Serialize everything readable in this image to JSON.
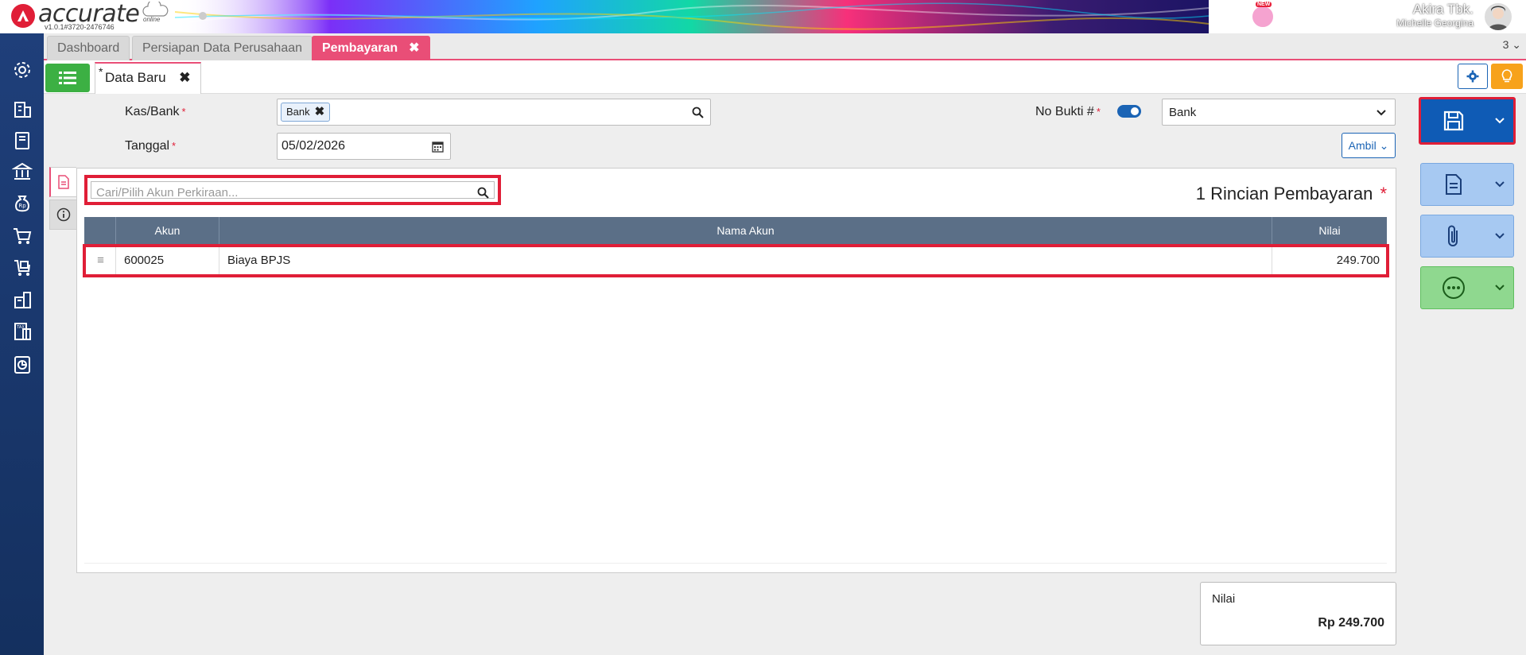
{
  "app": {
    "name": "accurate",
    "subtitle": "online",
    "version": "v1.0.1#3720-2476746"
  },
  "user": {
    "company": "Akira Tbk.",
    "name": "Michelle Georgina",
    "new_badge": "NEW"
  },
  "tabs": [
    {
      "label": "Dashboard"
    },
    {
      "label": "Persiapan Data Perusahaan"
    },
    {
      "label": "Pembayaran",
      "close": "✖"
    }
  ],
  "tab_count": "3",
  "doc_tab": {
    "label": "Data Baru",
    "modified_mark": "*",
    "close": "✖"
  },
  "form": {
    "kas_bank_label": "Kas/Bank",
    "kas_bank_value": "Bank",
    "tanggal_label": "Tanggal",
    "tanggal_value": "05/02/2026",
    "no_bukti_label": "No Bukti #",
    "no_bukti_type": "Bank",
    "required_mark": "*",
    "ambil_label": "Ambil"
  },
  "detail": {
    "search_placeholder": "Cari/Pilih Akun Perkiraan...",
    "title": "1 Rincian Pembayaran",
    "columns": [
      "Akun",
      "Nama Akun",
      "Nilai"
    ],
    "rows": [
      {
        "akun": "600025",
        "nama_akun": "Biaya BPJS",
        "nilai": "249.700"
      }
    ]
  },
  "total": {
    "label": "Nilai",
    "value": "Rp 249.700"
  },
  "colors": {
    "accent": "#e94e77",
    "primary": "#0f5bb5",
    "success": "#3cb043",
    "header_table": "#5b6f87"
  }
}
